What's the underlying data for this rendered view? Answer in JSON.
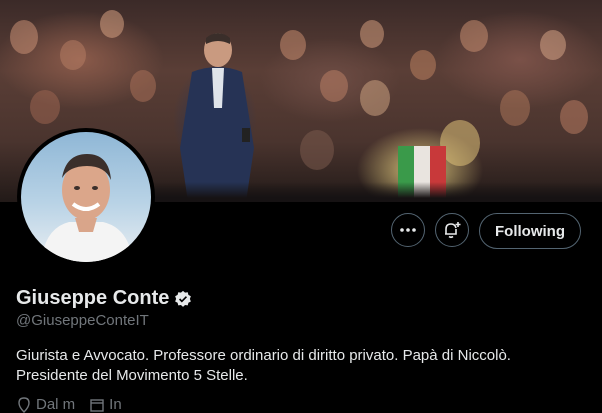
{
  "profile": {
    "name": "Giuseppe Conte",
    "handle": "@GiuseppeConteIT",
    "bio_line1": "Giurista e Avvocato. Professore ordinario di diritto privato. Papà di Niccolò.",
    "bio_line2": "Presidente del Movimento 5 Stelle.",
    "verified": true
  },
  "actions": {
    "more_icon": "more-dots-icon",
    "notify_icon": "bell-plus-icon",
    "follow_label": "Following"
  },
  "meta": {
    "location_text": "Dal m",
    "joined_text": "In"
  },
  "colors": {
    "background": "#000000",
    "text_primary": "#e7e9ea",
    "text_secondary": "#71767b",
    "border": "#536471",
    "verified_badge": "#e7e9ea"
  }
}
